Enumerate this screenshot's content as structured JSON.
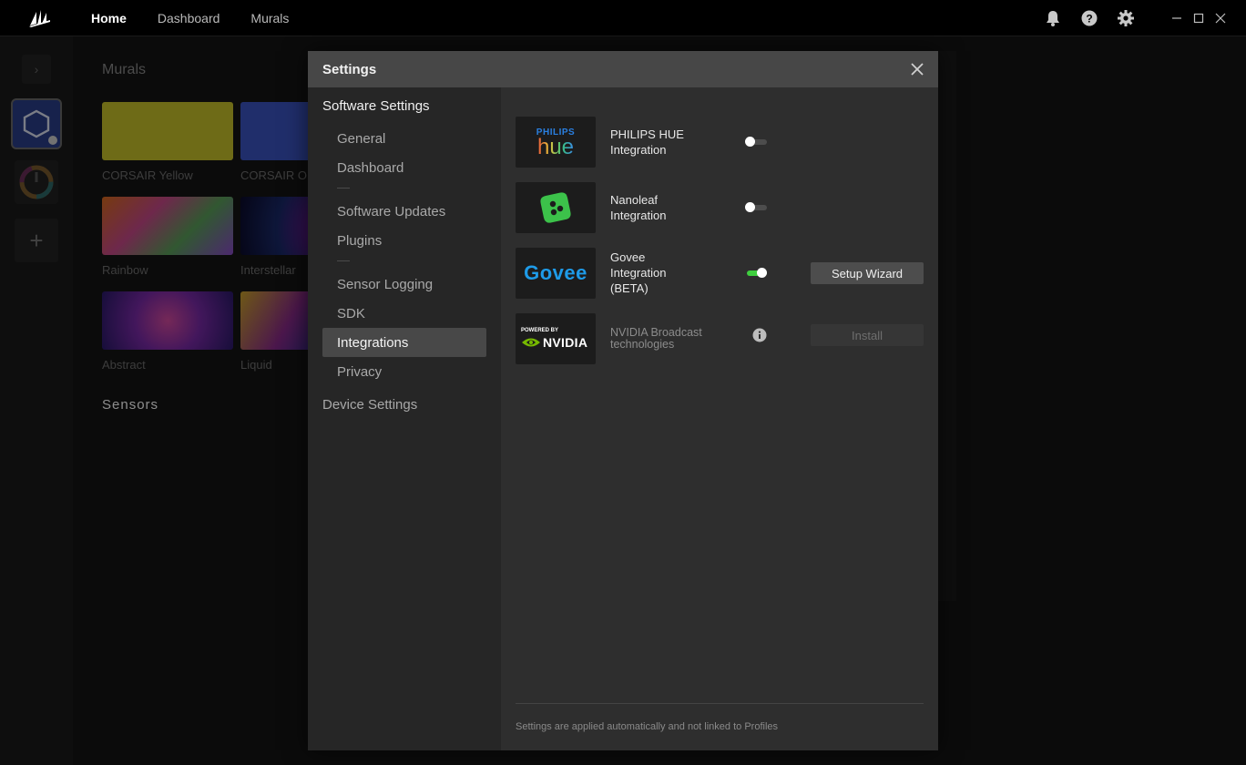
{
  "topbar": {
    "tabs": [
      {
        "label": "Home",
        "active": true
      },
      {
        "label": "Dashboard",
        "active": false
      },
      {
        "label": "Murals",
        "active": false
      }
    ],
    "icons": [
      "bell-icon",
      "help-icon",
      "gear-icon"
    ],
    "window_controls": [
      "minimize",
      "maximize",
      "close"
    ]
  },
  "rail": {
    "expand_glyph": "›",
    "add_glyph": "+"
  },
  "murals": {
    "title": "Murals",
    "items": [
      {
        "label": "CORSAIR Yellow"
      },
      {
        "label": "CORSAIR ON"
      },
      {
        "label": "Rainbow"
      },
      {
        "label": "Interstellar"
      },
      {
        "label": "Abstract"
      },
      {
        "label": "Liquid"
      }
    ],
    "sensors_title": "Sensors"
  },
  "modal": {
    "title": "Settings",
    "nav": {
      "software_settings": "Software Settings",
      "items": {
        "general": "General",
        "dashboard": "Dashboard",
        "software_updates": "Software Updates",
        "plugins": "Plugins",
        "sensor_logging": "Sensor Logging",
        "sdk": "SDK",
        "integrations": "Integrations",
        "privacy": "Privacy"
      },
      "device_settings": "Device Settings",
      "active": "Integrations"
    },
    "integrations": [
      {
        "id": "philips-hue",
        "logo_top": "PHILIPS",
        "logo_main": "hue",
        "label_line1": "PHILIPS HUE",
        "label_line2": "Integration",
        "enabled": false
      },
      {
        "id": "nanoleaf",
        "label_line1": "Nanoleaf",
        "label_line2": "Integration",
        "enabled": false
      },
      {
        "id": "govee",
        "logo_main": "Govee",
        "label_line1": "Govee",
        "label_line2": "Integration",
        "label_line3": "(BETA)",
        "enabled": true,
        "button": "Setup Wizard"
      },
      {
        "id": "nvidia",
        "logo_top": "POWERED BY",
        "logo_main": "NVIDIA",
        "label_line1": "NVIDIA Broadcast",
        "label_line2": "technologies",
        "button": "Install",
        "button_disabled": true
      }
    ],
    "footer_note": "Settings are applied automatically and not linked to Profiles"
  },
  "colors": {
    "accent_green": "#3fcf3f",
    "govee_blue": "#1e9be8",
    "nvidia_green": "#76b900",
    "nanoleaf_green": "#3cc24a"
  }
}
